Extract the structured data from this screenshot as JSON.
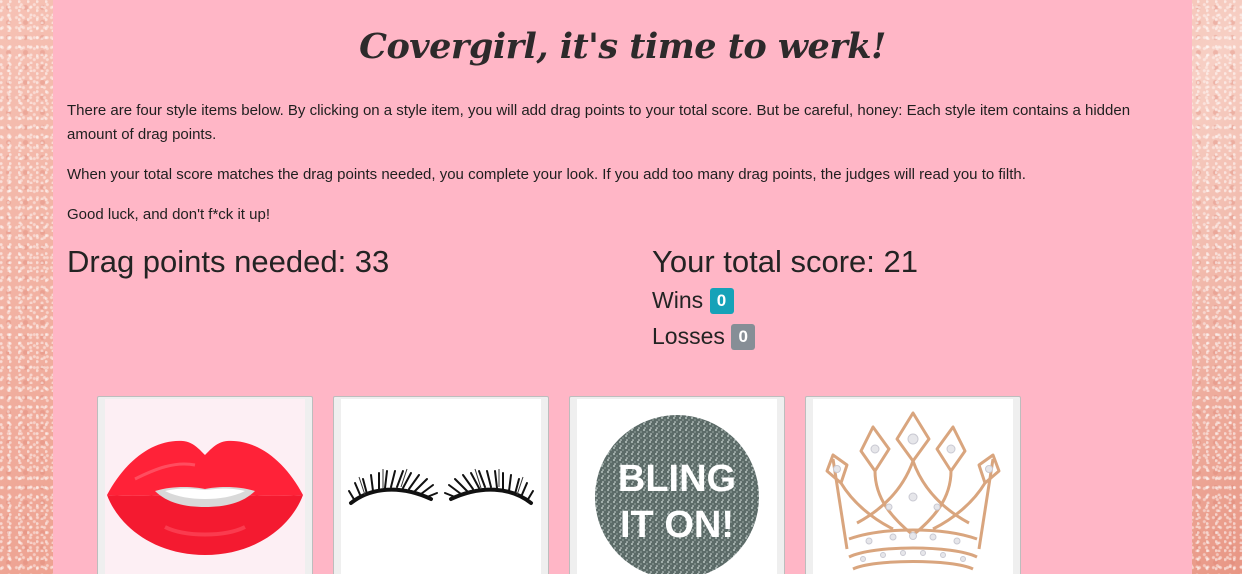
{
  "header": {
    "title": "Covergirl, it's time to werk!"
  },
  "intro": {
    "paragraph_1": "There are four style items below. By clicking on a style item, you will add drag points to your total score. But be careful, honey: Each style item contains a hidden amount of drag points.",
    "paragraph_2": "When your total score matches the drag points needed, you complete your look. If you add too many drag points, the judges will read you to filth.",
    "paragraph_3": "Good luck, and don't f*ck it up!"
  },
  "stats": {
    "needed_text": "Drag points needed: 33",
    "total_text": "Your total score: 21",
    "wins_label": "Wins",
    "wins_count": "0",
    "losses_label": "Losses",
    "losses_count": "0"
  },
  "items": [
    {
      "name": "lips",
      "icon": "lips-icon"
    },
    {
      "name": "eyelashes",
      "icon": "eyelashes-icon"
    },
    {
      "name": "bling",
      "icon": "bling-it-on-icon",
      "text_line_1": "BLING",
      "text_line_2": "IT ON!"
    },
    {
      "name": "crown",
      "icon": "crown-icon"
    }
  ],
  "colors": {
    "panel": "#ffb6c6",
    "wins_badge": "#16a2b8",
    "losses_badge": "#868e96",
    "lips": "#ff2238"
  }
}
